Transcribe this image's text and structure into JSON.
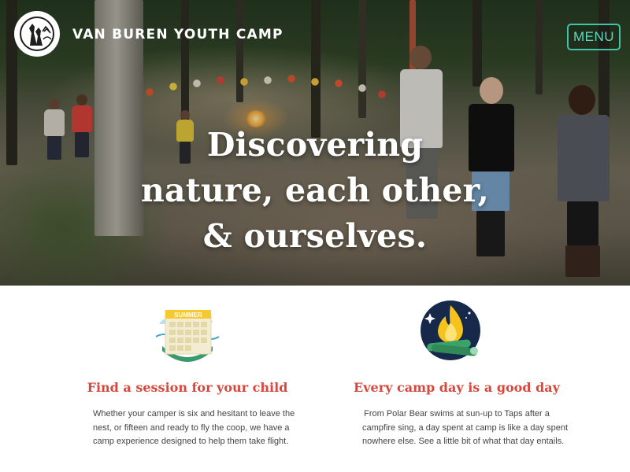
{
  "header": {
    "brand": "VAN BUREN YOUTH CAMP",
    "menu_label": "MENU",
    "logo_icon": "camp-logo-icon",
    "menu_color": "#3fc5a8"
  },
  "hero": {
    "headline_lines": [
      "Discovering",
      "nature, each other,",
      "& ourselves."
    ],
    "background_description_color": "#34482a"
  },
  "features": [
    {
      "icon": "summer-calendar-icon",
      "title": "Find a session for your child",
      "text_lines": [
        "Whether your camper is six and hesitant to leave the",
        "nest, or fifteen and ready to fly the coop, we have a",
        "camp experience designed to help them take flight."
      ],
      "icon_label": "SUMMER"
    },
    {
      "icon": "campfire-icon",
      "title": "Every camp day is a good day",
      "text_lines": [
        "From Polar Bear swims at sun-up to Taps after a",
        "campfire sing, a day spent at camp is like a day spent",
        "nowhere else. See a little bit of what that day entails."
      ]
    }
  ],
  "colors": {
    "accent_red": "#d8473d",
    "accent_teal": "#3fc5a8",
    "body_text": "#444444"
  }
}
